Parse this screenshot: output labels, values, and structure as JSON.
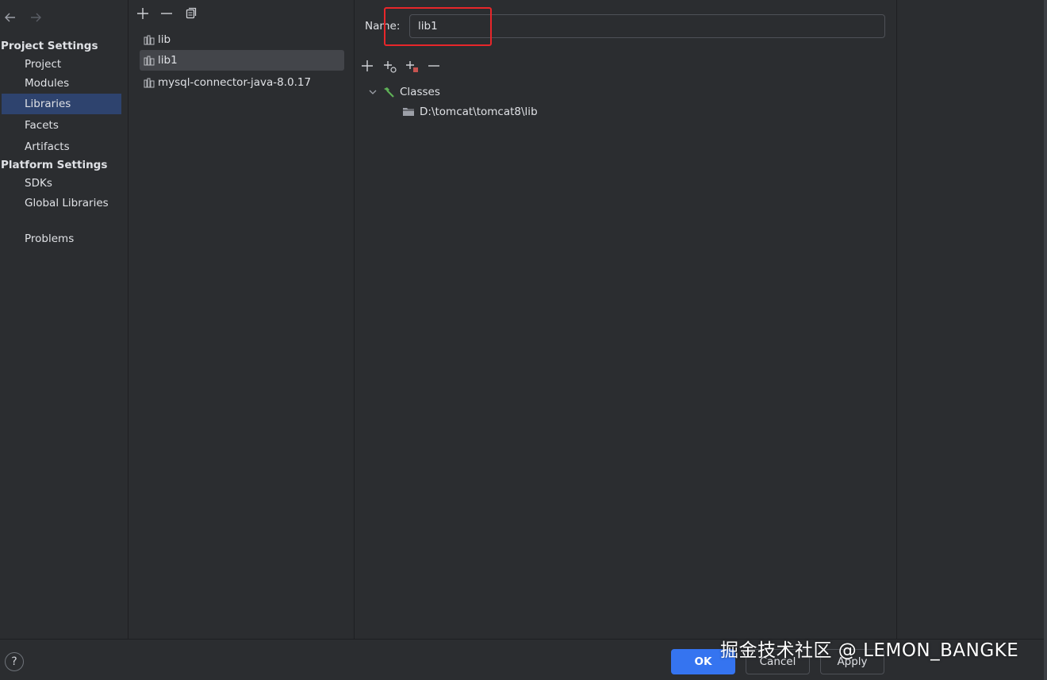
{
  "nav": {
    "back_icon": "arrow-left-icon",
    "forward_icon": "arrow-right-icon",
    "project_settings_header": "Project Settings",
    "platform_settings_header": "Platform Settings",
    "items": [
      {
        "label": "Project"
      },
      {
        "label": "Modules"
      },
      {
        "label": "Libraries"
      },
      {
        "label": "Facets"
      },
      {
        "label": "Artifacts"
      },
      {
        "label": "SDKs"
      },
      {
        "label": "Global Libraries"
      },
      {
        "label": "Problems"
      }
    ],
    "selected": "Libraries"
  },
  "libraries": {
    "toolbar": [
      "plus-icon",
      "minus-icon",
      "copy-icon"
    ],
    "items": [
      {
        "label": "lib"
      },
      {
        "label": "lib1"
      },
      {
        "label": "mysql-connector-java-8.0.17"
      }
    ],
    "selected": "lib1"
  },
  "detail": {
    "name_label": "Name:",
    "name_value": "lib1",
    "toolbar": [
      "add-icon",
      "add-jar-icon",
      "add-url-icon",
      "remove-icon"
    ],
    "tree": {
      "root_label": "Classes",
      "child_label": "D:\\tomcat\\tomcat8\\lib"
    }
  },
  "footer": {
    "help": "?",
    "ok": "OK",
    "cancel": "Cancel",
    "apply": "Apply"
  },
  "watermark": "掘金技术社区 @ LEMON_BANGKE",
  "colors": {
    "accent": "#3574f0",
    "selection": "#2e436e",
    "highlight_box": "#e8262a"
  }
}
